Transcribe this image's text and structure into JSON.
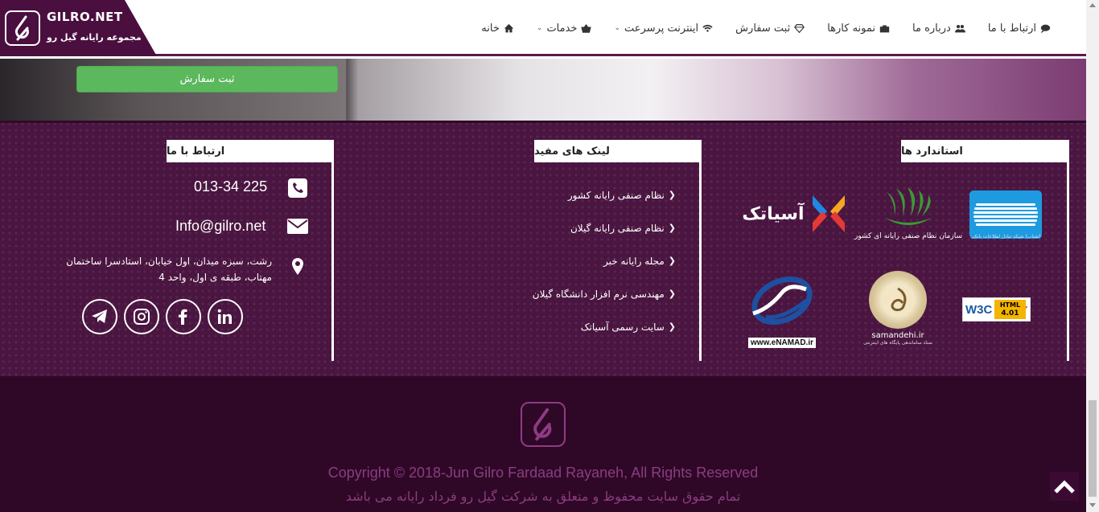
{
  "header": {
    "logo_title": "GILRO.NET",
    "logo_subtitle": "مجموعه رایانه گیل رو",
    "nav": [
      {
        "label": "خانه",
        "icon": "home-icon"
      },
      {
        "label": "خدمات",
        "icon": "basket-icon",
        "dropdown": true
      },
      {
        "label": "اینترنت پرسرعت",
        "icon": "wifi-icon",
        "dropdown": true
      },
      {
        "label": "ثبت سفارش",
        "icon": "diamond-icon"
      },
      {
        "label": "نمونه کارها",
        "icon": "briefcase-icon"
      },
      {
        "label": "درباره ما",
        "icon": "users-icon"
      },
      {
        "label": "ارتباط با ما",
        "icon": "comment-icon"
      }
    ]
  },
  "banner": {
    "order_button": "ثبت سفارش"
  },
  "footer": {
    "contact": {
      "title": "ارتباط با ما",
      "phone": "013-34 225",
      "email": "Info@gilro.net",
      "address": "رشت، سبزه میدان، اول خیابان، استادسرا ساختمان مهتاب، طبقه ی اول، واحد 4"
    },
    "links": {
      "title": "لینک های مفید",
      "items": [
        "نظام صنفی رایانه کشور",
        "نظام صنفی رایانه گیلان",
        "مجله رایانه خبر",
        "مهندسی نرم افزار دانشگاه گیلان",
        "سایت رسمی آسیاتک"
      ]
    },
    "standards": {
      "title": "استاندارد ها",
      "asiatech": "آسیاتک",
      "nezam": "سازمان نظام صنفی رایانه ای کشور",
      "shetab": "(شتاب) شبکه تبادل اطلاعات بانکی",
      "w3c": "W3C",
      "html": "HTML",
      "html_version": "4.01",
      "samandehi": "samandehi.ir",
      "samandehi_sub": "ستاد ساماندهی پایگاه های اینترنتی",
      "enamad": "www.eNAMAD.ir"
    }
  },
  "bottom": {
    "copyright_en": "Copyright © 2018-Jun Gilro Fardaad Rayaneh, All Rights Reserved",
    "copyright_fa": "تمام حقوق سایت محفوظ و متعلق به شرکت گیل رو فرداد رایانه می باشد"
  },
  "colors": {
    "footer_bg": "#4a1540",
    "bottom_bg": "#2f0827",
    "accent": "#8a3d80",
    "button_green": "#5cb85c"
  }
}
